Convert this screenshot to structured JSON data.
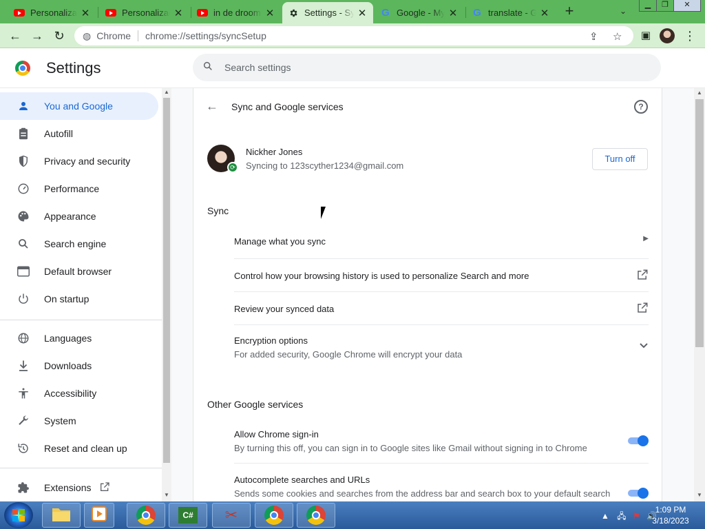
{
  "tabs": [
    {
      "label": "Personalizac",
      "icon": "youtube-icon"
    },
    {
      "label": "Personalizaci",
      "icon": "youtube-icon"
    },
    {
      "label": "in de droom",
      "icon": "youtube-icon"
    },
    {
      "label": "Settings - Syn",
      "icon": "gear-icon",
      "active": true
    },
    {
      "label": "Google - My",
      "icon": "google-icon"
    },
    {
      "label": "translate - G",
      "icon": "google-icon"
    }
  ],
  "tab_close": "✕",
  "new_tab": "+",
  "omnibox": {
    "site": "Chrome",
    "url": "chrome://settings/syncSetup"
  },
  "header": {
    "title": "Settings",
    "search_placeholder": "Search settings"
  },
  "sidebar": {
    "items": [
      {
        "label": "You and Google",
        "icon": "person-icon",
        "active": true
      },
      {
        "label": "Autofill",
        "icon": "clipboard-icon"
      },
      {
        "label": "Privacy and security",
        "icon": "shield-icon"
      },
      {
        "label": "Performance",
        "icon": "speedometer-icon"
      },
      {
        "label": "Appearance",
        "icon": "palette-icon"
      },
      {
        "label": "Search engine",
        "icon": "search-icon"
      },
      {
        "label": "Default browser",
        "icon": "browser-icon"
      },
      {
        "label": "On startup",
        "icon": "power-icon"
      },
      {
        "label": "Languages",
        "icon": "globe-icon"
      },
      {
        "label": "Downloads",
        "icon": "download-icon"
      },
      {
        "label": "Accessibility",
        "icon": "accessibility-icon"
      },
      {
        "label": "System",
        "icon": "wrench-icon"
      },
      {
        "label": "Reset and clean up",
        "icon": "reset-icon"
      },
      {
        "label": "Extensions",
        "icon": "puzzle-icon"
      }
    ]
  },
  "page": {
    "title": "Sync and Google services",
    "account": {
      "name": "Nickher Jones",
      "email": "Syncing to 123scyther1234@gmail.com",
      "turn_off": "Turn off"
    },
    "sync_title": "Sync",
    "sync_rows": [
      {
        "label": "Manage what you sync",
        "icon": "arrow-right-icon"
      },
      {
        "label": "Control how your browsing history is used to personalize Search and more",
        "icon": "external-link-icon"
      },
      {
        "label": "Review your synced data",
        "icon": "external-link-icon"
      },
      {
        "label": "Encryption options",
        "sub": "For added security, Google Chrome will encrypt your data",
        "icon": "chevron-down-icon"
      }
    ],
    "other_title": "Other Google services",
    "other_rows": [
      {
        "label": "Allow Chrome sign-in",
        "sub": "By turning this off, you can sign in to Google sites like Gmail without signing in to Chrome",
        "on": true
      },
      {
        "label": "Autocomplete searches and URLs",
        "sub": "Sends some cookies and searches from the address bar and search box to your default search",
        "on": true
      }
    ]
  },
  "taskbar": {
    "time": "1:09 PM",
    "date": "3/18/2023",
    "apps": [
      "chrome-icon",
      "explorer-icon",
      "media-player-icon",
      "chrome-icon",
      "csharp-icon",
      "snipping-tool-icon",
      "chrome-icon",
      "chrome-icon"
    ]
  },
  "colors": {
    "accent": "#1a73e8",
    "nav_active_bg": "#e8f0fe",
    "tabstrip": "#5cb65c",
    "toolbar": "#d7efd2"
  }
}
